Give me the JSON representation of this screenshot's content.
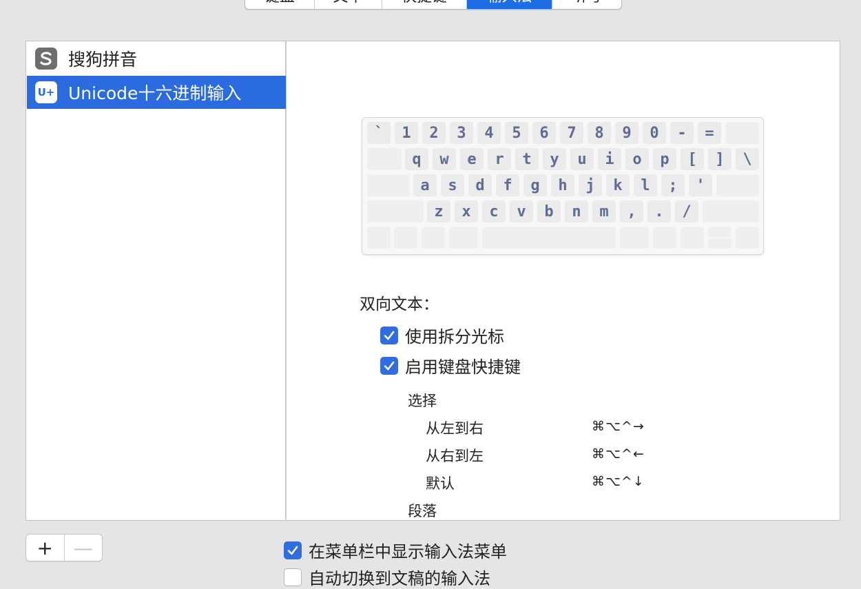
{
  "tabs": [
    {
      "label": "键盘",
      "active": false
    },
    {
      "label": "文本",
      "active": false
    },
    {
      "label": "快捷键",
      "active": false
    },
    {
      "label": "输入法",
      "active": true
    },
    {
      "label": "听写",
      "active": false
    }
  ],
  "input_sources": [
    {
      "label": "搜狗拼音",
      "icon": "sogou-icon",
      "selected": false
    },
    {
      "label": "Unicode十六进制输入",
      "icon": "unicode-hex-icon",
      "icon_text": "U+",
      "selected": true
    }
  ],
  "keyboard": {
    "row1": [
      "`",
      "1",
      "2",
      "3",
      "4",
      "5",
      "6",
      "7",
      "8",
      "9",
      "0",
      "-",
      "="
    ],
    "row2": [
      "q",
      "w",
      "e",
      "r",
      "t",
      "y",
      "u",
      "i",
      "o",
      "p",
      "[",
      "]",
      "\\"
    ],
    "row3": [
      "a",
      "s",
      "d",
      "f",
      "g",
      "h",
      "j",
      "k",
      "l",
      ";",
      "'"
    ],
    "row4": [
      "z",
      "x",
      "c",
      "v",
      "b",
      "n",
      "m",
      ",",
      ".",
      "/"
    ]
  },
  "bidi": {
    "title": "双向文本：",
    "split_cursor": {
      "label": "使用拆分光标",
      "checked": true
    },
    "keyboard_shortcuts": {
      "label": "启用键盘快捷键",
      "checked": true
    },
    "selection_heading": "选择",
    "shortcuts": [
      {
        "label": "从左到右",
        "keys": "⌘⌥^→"
      },
      {
        "label": "从右到左",
        "keys": "⌘⌥^←"
      },
      {
        "label": "默认",
        "keys": "⌘⌥^↓"
      }
    ],
    "paragraph_heading": "段落"
  },
  "buttons": {
    "add": "+",
    "remove": "—"
  },
  "bottom": {
    "show_menu": {
      "label": "在菜单栏中显示输入法菜单",
      "checked": true
    },
    "auto_switch": {
      "label": "自动切换到文稿的输入法",
      "checked": false
    }
  },
  "colors": {
    "accent": "#2a6be0",
    "key_text": "#5e6c97"
  }
}
